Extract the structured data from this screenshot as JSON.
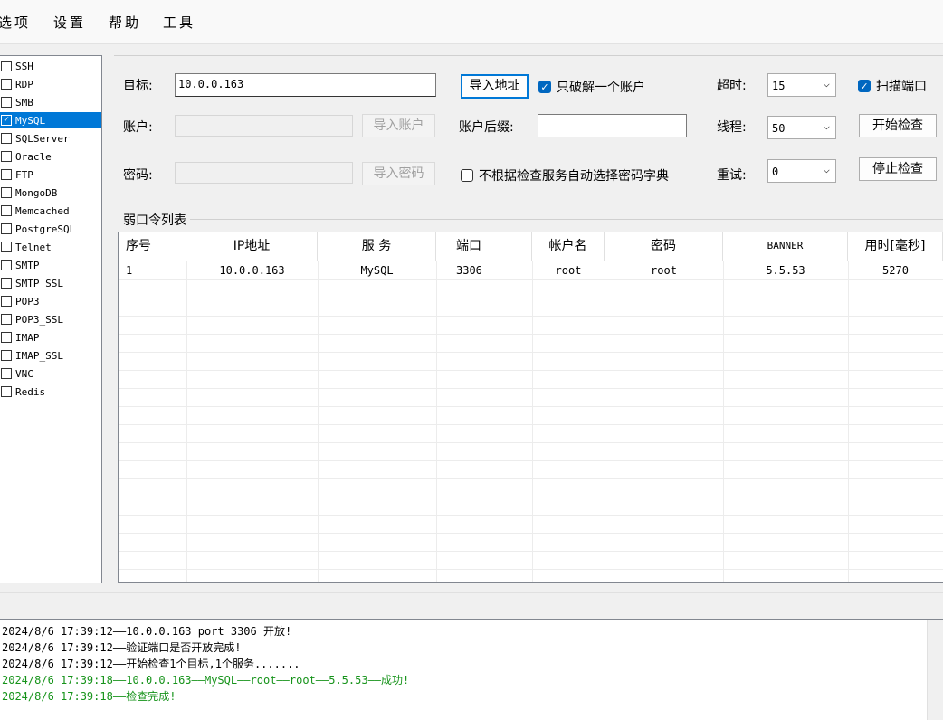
{
  "menu": [
    "选项",
    "设置",
    "帮助",
    "工具"
  ],
  "services": [
    {
      "name": "SSH",
      "checked": false,
      "selected": false
    },
    {
      "name": "RDP",
      "checked": false,
      "selected": false
    },
    {
      "name": "SMB",
      "checked": false,
      "selected": false
    },
    {
      "name": "MySQL",
      "checked": true,
      "selected": true
    },
    {
      "name": "SQLServer",
      "checked": false,
      "selected": false
    },
    {
      "name": "Oracle",
      "checked": false,
      "selected": false
    },
    {
      "name": "FTP",
      "checked": false,
      "selected": false
    },
    {
      "name": "MongoDB",
      "checked": false,
      "selected": false
    },
    {
      "name": "Memcached",
      "checked": false,
      "selected": false
    },
    {
      "name": "PostgreSQL",
      "checked": false,
      "selected": false
    },
    {
      "name": "Telnet",
      "checked": false,
      "selected": false
    },
    {
      "name": "SMTP",
      "checked": false,
      "selected": false
    },
    {
      "name": "SMTP_SSL",
      "checked": false,
      "selected": false
    },
    {
      "name": "POP3",
      "checked": false,
      "selected": false
    },
    {
      "name": "POP3_SSL",
      "checked": false,
      "selected": false
    },
    {
      "name": "IMAP",
      "checked": false,
      "selected": false
    },
    {
      "name": "IMAP_SSL",
      "checked": false,
      "selected": false
    },
    {
      "name": "VNC",
      "checked": false,
      "selected": false
    },
    {
      "name": "Redis",
      "checked": false,
      "selected": false
    }
  ],
  "config": {
    "target_label": "目标:",
    "target_value": "10.0.0.163",
    "import_address": "导入地址",
    "crack_one_label": "只破解一个账户",
    "crack_one_checked": true,
    "timeout_label": "超时:",
    "timeout_value": "15",
    "scan_port_label": "扫描端口",
    "scan_port_checked": true,
    "account_label": "账户:",
    "account_value": "",
    "import_account": "导入账户",
    "suffix_label": "账户后缀:",
    "suffix_value": "",
    "threads_label": "线程:",
    "threads_value": "50",
    "start_check": "开始检查",
    "password_label": "密码:",
    "password_value": "",
    "import_password": "导入密码",
    "auto_dict_label": "不根据检查服务自动选择密码字典",
    "auto_dict_checked": false,
    "retry_label": "重试:",
    "retry_value": "0",
    "stop_check": "停止检查"
  },
  "results": {
    "group_title": "弱口令列表",
    "columns": [
      "序号",
      "IP地址",
      "服 务",
      "端口",
      "帐户名",
      "密码",
      "BANNER",
      "用时[毫秒]"
    ],
    "rows": [
      [
        "1",
        "10.0.0.163",
        "MySQL",
        "3306",
        "root",
        "root",
        "5.5.53",
        "5270"
      ]
    ]
  },
  "log": [
    {
      "text": "2024/8/6 17:39:12——10.0.0.163 port 3306 开放!",
      "status": "normal"
    },
    {
      "text": "2024/8/6 17:39:12——验证端口是否开放完成!",
      "status": "normal"
    },
    {
      "text": "2024/8/6 17:39:12——开始检查1个目标,1个服务.......",
      "status": "normal"
    },
    {
      "text": "2024/8/6 17:39:18——10.0.0.163——MySQL——root——root——5.5.53——成功!",
      "status": "success"
    },
    {
      "text": "2024/8/6 17:39:18——检查完成!",
      "status": "success"
    }
  ]
}
